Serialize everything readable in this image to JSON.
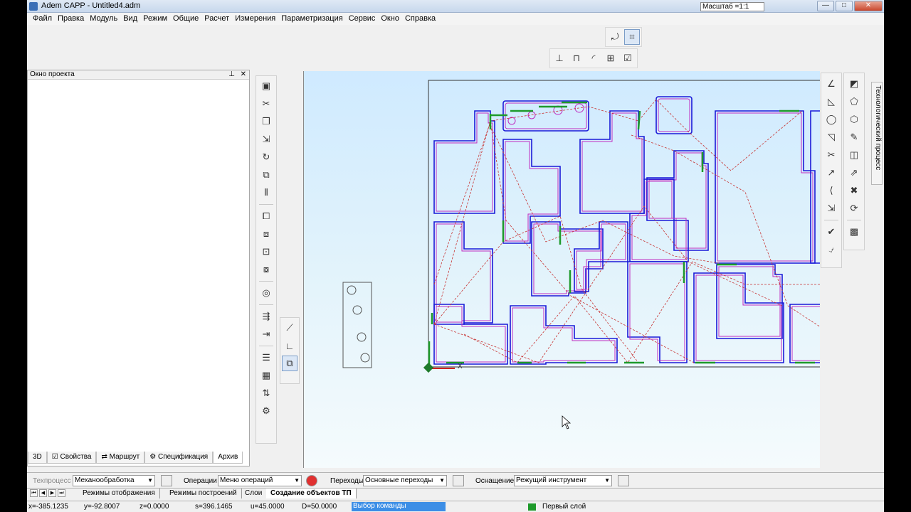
{
  "window": {
    "title": "Adem CAPP - Untitled4.adm",
    "scale_label": "Масштаб =1:1",
    "buttons": {
      "minimize": "—",
      "maximize": "□",
      "close": "✕"
    }
  },
  "menu": [
    "Файл",
    "Правка",
    "Модуль",
    "Вид",
    "Режим",
    "Общие",
    "Расчет",
    "Измерения",
    "Параметризация",
    "Сервис",
    "Окно",
    "Справка"
  ],
  "project_panel": {
    "title": "Окно проекта",
    "pin": "⊥",
    "close": "✕",
    "tabs": [
      "3D",
      "Свойства",
      "Маршрут",
      "Спецификация",
      "Архив"
    ],
    "active_tab": "Архив"
  },
  "right_panel_tab": "Технологический процесс",
  "tp_bar": {
    "process_label": "Техпроцесс",
    "process_value": "Механообработка",
    "operations_label": "Операции",
    "operations_value": "Меню операций",
    "transitions_label": "Переходы",
    "transitions_value": "Основные переходы",
    "equipment_label": "Оснащение",
    "equipment_value": "Режущий инструмент"
  },
  "sheet_tabs": [
    "Режимы отображения",
    "Режимы построений",
    "Слои",
    "Создание объектов ТП"
  ],
  "active_sheet_tab": "Создание объектов ТП",
  "status": {
    "x": "x=-385.1235",
    "y": "y=-92.8007",
    "z": "z=0.0000",
    "s": "s=396.1465",
    "u": "u=45.0000",
    "d": "D=50.0000",
    "command": "Выбор команды",
    "layer": "Первый слой",
    "layer_color": "#1e9a2b"
  },
  "canvas": {
    "axis_label": "X",
    "colors": {
      "contour": "#1a1ad8",
      "offset": "#c02cc0",
      "path": "#c83232",
      "move": "#1e9a2b"
    }
  }
}
